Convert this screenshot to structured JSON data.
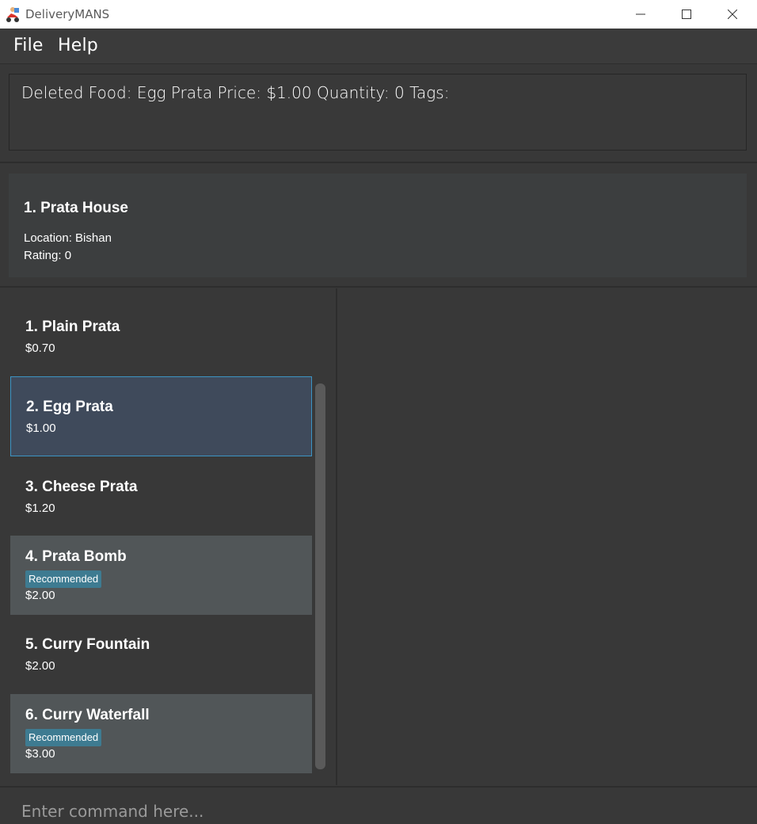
{
  "window": {
    "title": "DeliveryMANS"
  },
  "menu": {
    "file": "File",
    "help": "Help"
  },
  "result": {
    "text": "Deleted Food: Egg Prata Price: $1.00 Quantity: 0 Tags:"
  },
  "vendor": {
    "name": "1.  Prata House",
    "location": "Location: Bishan",
    "rating": "Rating: 0"
  },
  "foods": [
    {
      "name": "1.  Plain Prata",
      "price": "$0.70",
      "tag": ""
    },
    {
      "name": "2.  Egg Prata",
      "price": "$1.00",
      "tag": ""
    },
    {
      "name": "3.  Cheese Prata",
      "price": "$1.20",
      "tag": ""
    },
    {
      "name": "4.  Prata Bomb",
      "price": "$2.00",
      "tag": "Recommended"
    },
    {
      "name": "5.  Curry Fountain",
      "price": "$2.00",
      "tag": ""
    },
    {
      "name": "6.  Curry Waterfall",
      "price": "$3.00",
      "tag": "Recommended"
    }
  ],
  "command": {
    "placeholder": "Enter command here..."
  },
  "colors": {
    "background": "#383838",
    "tag": "#3e7b91",
    "selection_border": "#3c94c4"
  },
  "icons": {
    "app": "scooter-delivery-icon",
    "minimize": "minimize-icon",
    "maximize": "maximize-icon",
    "close": "close-icon"
  }
}
